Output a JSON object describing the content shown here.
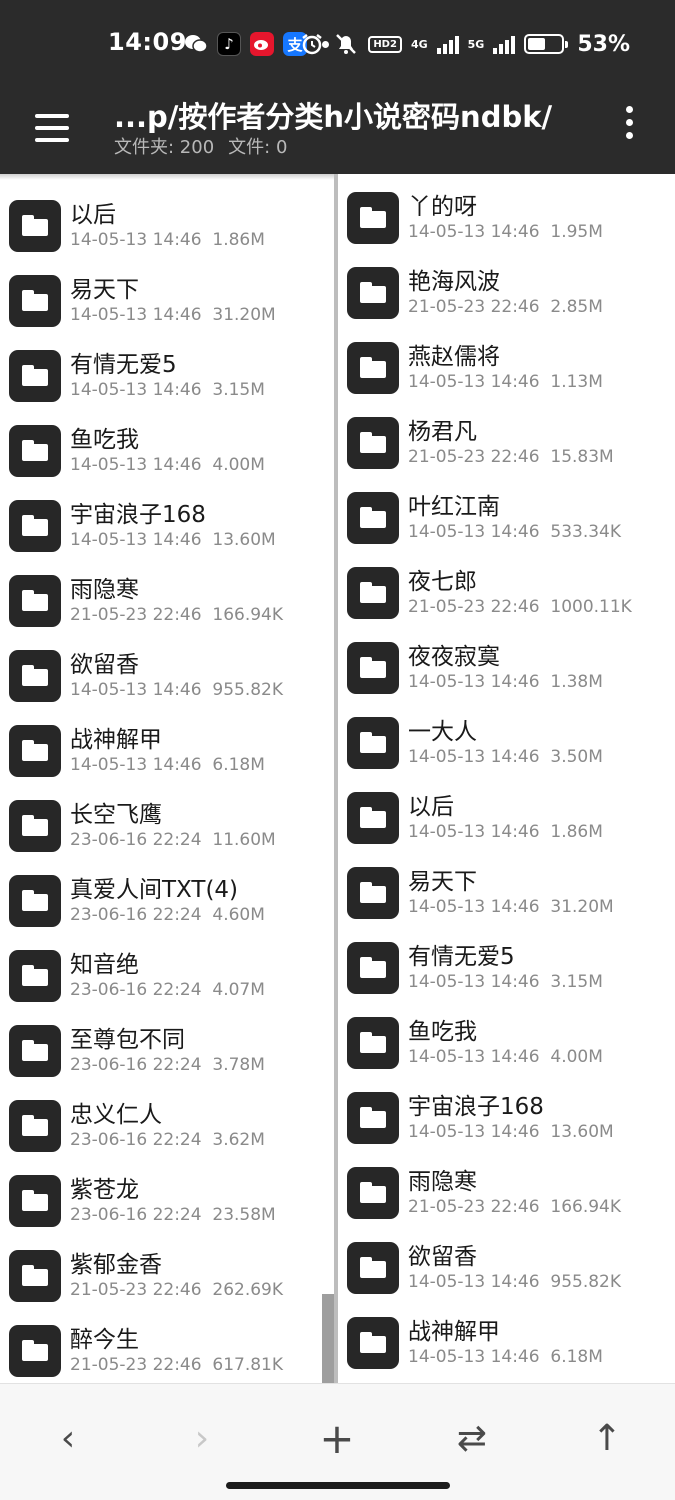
{
  "status_bar": {
    "time": "14:09",
    "icons": [
      "wechat-icon",
      "tiktok-icon",
      "weibo-icon",
      "alipay-icon"
    ],
    "hd_label": "HD2",
    "signal1_label": "4G",
    "signal2_label": "5G",
    "battery_percent": "53%",
    "battery_level": 0.53
  },
  "toolbar": {
    "path": "...p/按作者分类h小说密码ndbk/",
    "folders_label": "文件夹: 200",
    "files_label": "文件: 0"
  },
  "left_pane": {
    "items": [
      {
        "name": "以后",
        "date": "14-05-13 14:46",
        "size": "1.86M"
      },
      {
        "name": "易天下",
        "date": "14-05-13 14:46",
        "size": "31.20M"
      },
      {
        "name": "有情无爱5",
        "date": "14-05-13 14:46",
        "size": "3.15M"
      },
      {
        "name": "鱼吃我",
        "date": "14-05-13 14:46",
        "size": "4.00M"
      },
      {
        "name": "宇宙浪子168",
        "date": "14-05-13 14:46",
        "size": "13.60M"
      },
      {
        "name": "雨隐寒",
        "date": "21-05-23 22:46",
        "size": "166.94K"
      },
      {
        "name": "欲留香",
        "date": "14-05-13 14:46",
        "size": "955.82K"
      },
      {
        "name": "战神解甲",
        "date": "14-05-13 14:46",
        "size": "6.18M"
      },
      {
        "name": "长空飞鹰",
        "date": "23-06-16 22:24",
        "size": "11.60M"
      },
      {
        "name": "真爱人间TXT(4)",
        "date": "23-06-16 22:24",
        "size": "4.60M"
      },
      {
        "name": "知音绝",
        "date": "23-06-16 22:24",
        "size": "4.07M"
      },
      {
        "name": "至尊包不同",
        "date": "23-06-16 22:24",
        "size": "3.78M"
      },
      {
        "name": "忠义仁人",
        "date": "23-06-16 22:24",
        "size": "3.62M"
      },
      {
        "name": "紫苍龙",
        "date": "23-06-16 22:24",
        "size": "23.58M"
      },
      {
        "name": "紫郁金香",
        "date": "21-05-23 22:46",
        "size": "262.69K"
      },
      {
        "name": "醉今生",
        "date": "21-05-23 22:46",
        "size": "617.81K"
      }
    ]
  },
  "right_pane": {
    "items": [
      {
        "name": "丫的呀",
        "date": "14-05-13 14:46",
        "size": "1.95M"
      },
      {
        "name": "艳海风波",
        "date": "21-05-23 22:46",
        "size": "2.85M"
      },
      {
        "name": "燕赵儒将",
        "date": "14-05-13 14:46",
        "size": "1.13M"
      },
      {
        "name": "杨君凡",
        "date": "21-05-23 22:46",
        "size": "15.83M"
      },
      {
        "name": "叶红江南",
        "date": "14-05-13 14:46",
        "size": "533.34K"
      },
      {
        "name": "夜七郎",
        "date": "21-05-23 22:46",
        "size": "1000.11K"
      },
      {
        "name": "夜夜寂寞",
        "date": "14-05-13 14:46",
        "size": "1.38M"
      },
      {
        "name": "一大人",
        "date": "14-05-13 14:46",
        "size": "3.50M"
      },
      {
        "name": "以后",
        "date": "14-05-13 14:46",
        "size": "1.86M"
      },
      {
        "name": "易天下",
        "date": "14-05-13 14:46",
        "size": "31.20M"
      },
      {
        "name": "有情无爱5",
        "date": "14-05-13 14:46",
        "size": "3.15M"
      },
      {
        "name": "鱼吃我",
        "date": "14-05-13 14:46",
        "size": "4.00M"
      },
      {
        "name": "宇宙浪子168",
        "date": "14-05-13 14:46",
        "size": "13.60M"
      },
      {
        "name": "雨隐寒",
        "date": "21-05-23 22:46",
        "size": "166.94K"
      },
      {
        "name": "欲留香",
        "date": "14-05-13 14:46",
        "size": "955.82K"
      },
      {
        "name": "战神解甲",
        "date": "14-05-13 14:46",
        "size": "6.18M"
      }
    ]
  },
  "bottom_bar": {
    "back_glyph": "‹",
    "forward_glyph": "›",
    "add_glyph": "+",
    "swap_glyph": "⇄",
    "up_glyph": "↑"
  }
}
